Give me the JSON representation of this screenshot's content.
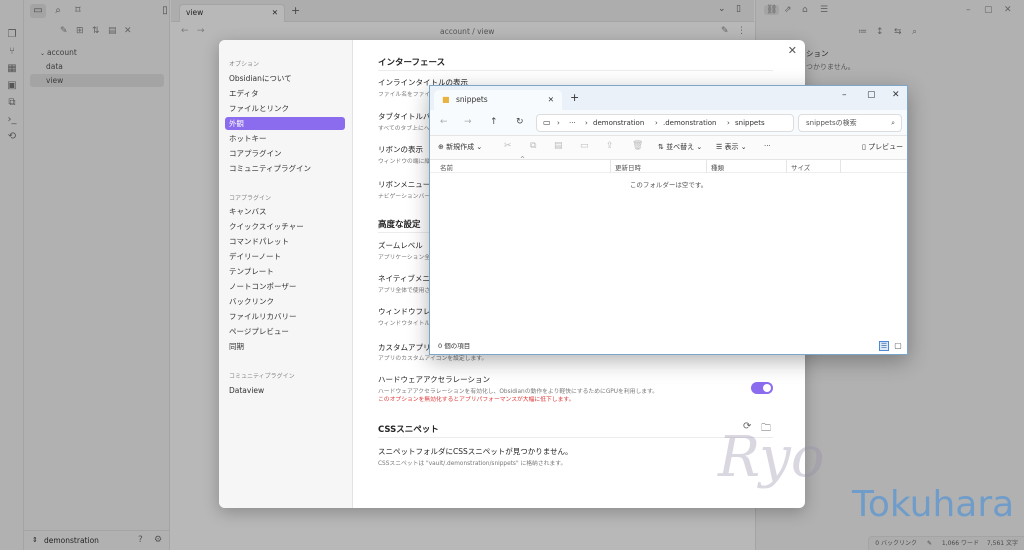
{
  "left_tree": {
    "folder": "account",
    "items": [
      "data",
      "view"
    ]
  },
  "vault": {
    "name": "demonstration"
  },
  "editor": {
    "tab_title": "view",
    "breadcrumb": "account / view"
  },
  "right_pane": {
    "outline_partial": "ション",
    "outline_empty_partial": "つかりません。"
  },
  "statusbar": {
    "backlinks": "0 バックリンク",
    "words": "1,066 ワード",
    "chars": "7,561 文字"
  },
  "settings": {
    "side_options_head": "オプション",
    "side_options": [
      "Obsidianについて",
      "エディタ",
      "ファイルとリンク",
      "外観",
      "ホットキー",
      "コアプラグイン",
      "コミュニティプラグイン"
    ],
    "side_core_head": "コアプラグイン",
    "side_core": [
      "キャンバス",
      "クイックスイッチャー",
      "コマンドパレット",
      "デイリーノート",
      "テンプレート",
      "ノートコンポーザー",
      "バックリンク",
      "ファイルリカバリー",
      "ページプレビュー",
      "同期"
    ],
    "side_community_head": "コミュニティプラグイン",
    "side_community": [
      "Dataview"
    ],
    "section_interface": "インターフェース",
    "inline_title_name": "インラインタイトルの表示",
    "inline_title_desc": "ファイル名をファイルの",
    "tab_title_bar_name": "タブタイトルバーの",
    "tab_title_bar_desc": "すべてのタブ上にヘッ",
    "ribbon_name": "リボンの表示",
    "ribbon_desc": "ウィンドウの端に縦長",
    "ribbon_menu_name": "リボンメニュー",
    "ribbon_menu_desc": "ナビゲーションバーの",
    "section_advanced": "高度な設定",
    "zoom_name": "ズームレベル",
    "zoom_desc": "アプリケーション全体",
    "native_menu_name": "ネイティブメニュー",
    "native_menu_desc": "アプリ全体で使用さ",
    "window_frame_name": "ウィンドウフレーム",
    "window_frame_desc": "ウィンドウタイトルバ",
    "custom_icon_name": "カスタムアプリア",
    "custom_icon_desc": "アプリのカスタムアイコンを設定します。",
    "hw_accel_name": "ハードウェアアクセラレーション",
    "hw_accel_desc": "ハードウェアアクセラレーションを有効化し、Obsidianの動作をより軽快にするためにGPUを利用します。",
    "hw_accel_warn": "このオプションを無効化するとアプリパフォーマンスが大幅に低下します。",
    "section_css": "CSSスニペット",
    "css_none_name": "スニペットフォルダにCSSスニペットが見つかりません。",
    "css_none_desc": "CSSスニペットは \"vault/.demonstration/snippets\" に格納されます。"
  },
  "explorer": {
    "tab_title": "snippets",
    "path": [
      "demonstration",
      ".demonstration",
      "snippets"
    ],
    "path_ellipsis": "···",
    "search_placeholder": "snippetsの検索",
    "new_label": "新規作成",
    "sort_label": "並べ替え",
    "view_label": "表示",
    "more_label": "···",
    "preview_label": "プレビュー",
    "columns": [
      "名前",
      "更新日時",
      "種類",
      "サイズ"
    ],
    "empty_text": "このフォルダーは空です。",
    "item_count": "0 個の項目"
  },
  "watermark": {
    "signature": "Ryo",
    "name": "Tokuhara"
  },
  "colors": {
    "accent": "#8b6cef",
    "warn": "#e03636",
    "explorer_border": "#7aa6c9"
  }
}
